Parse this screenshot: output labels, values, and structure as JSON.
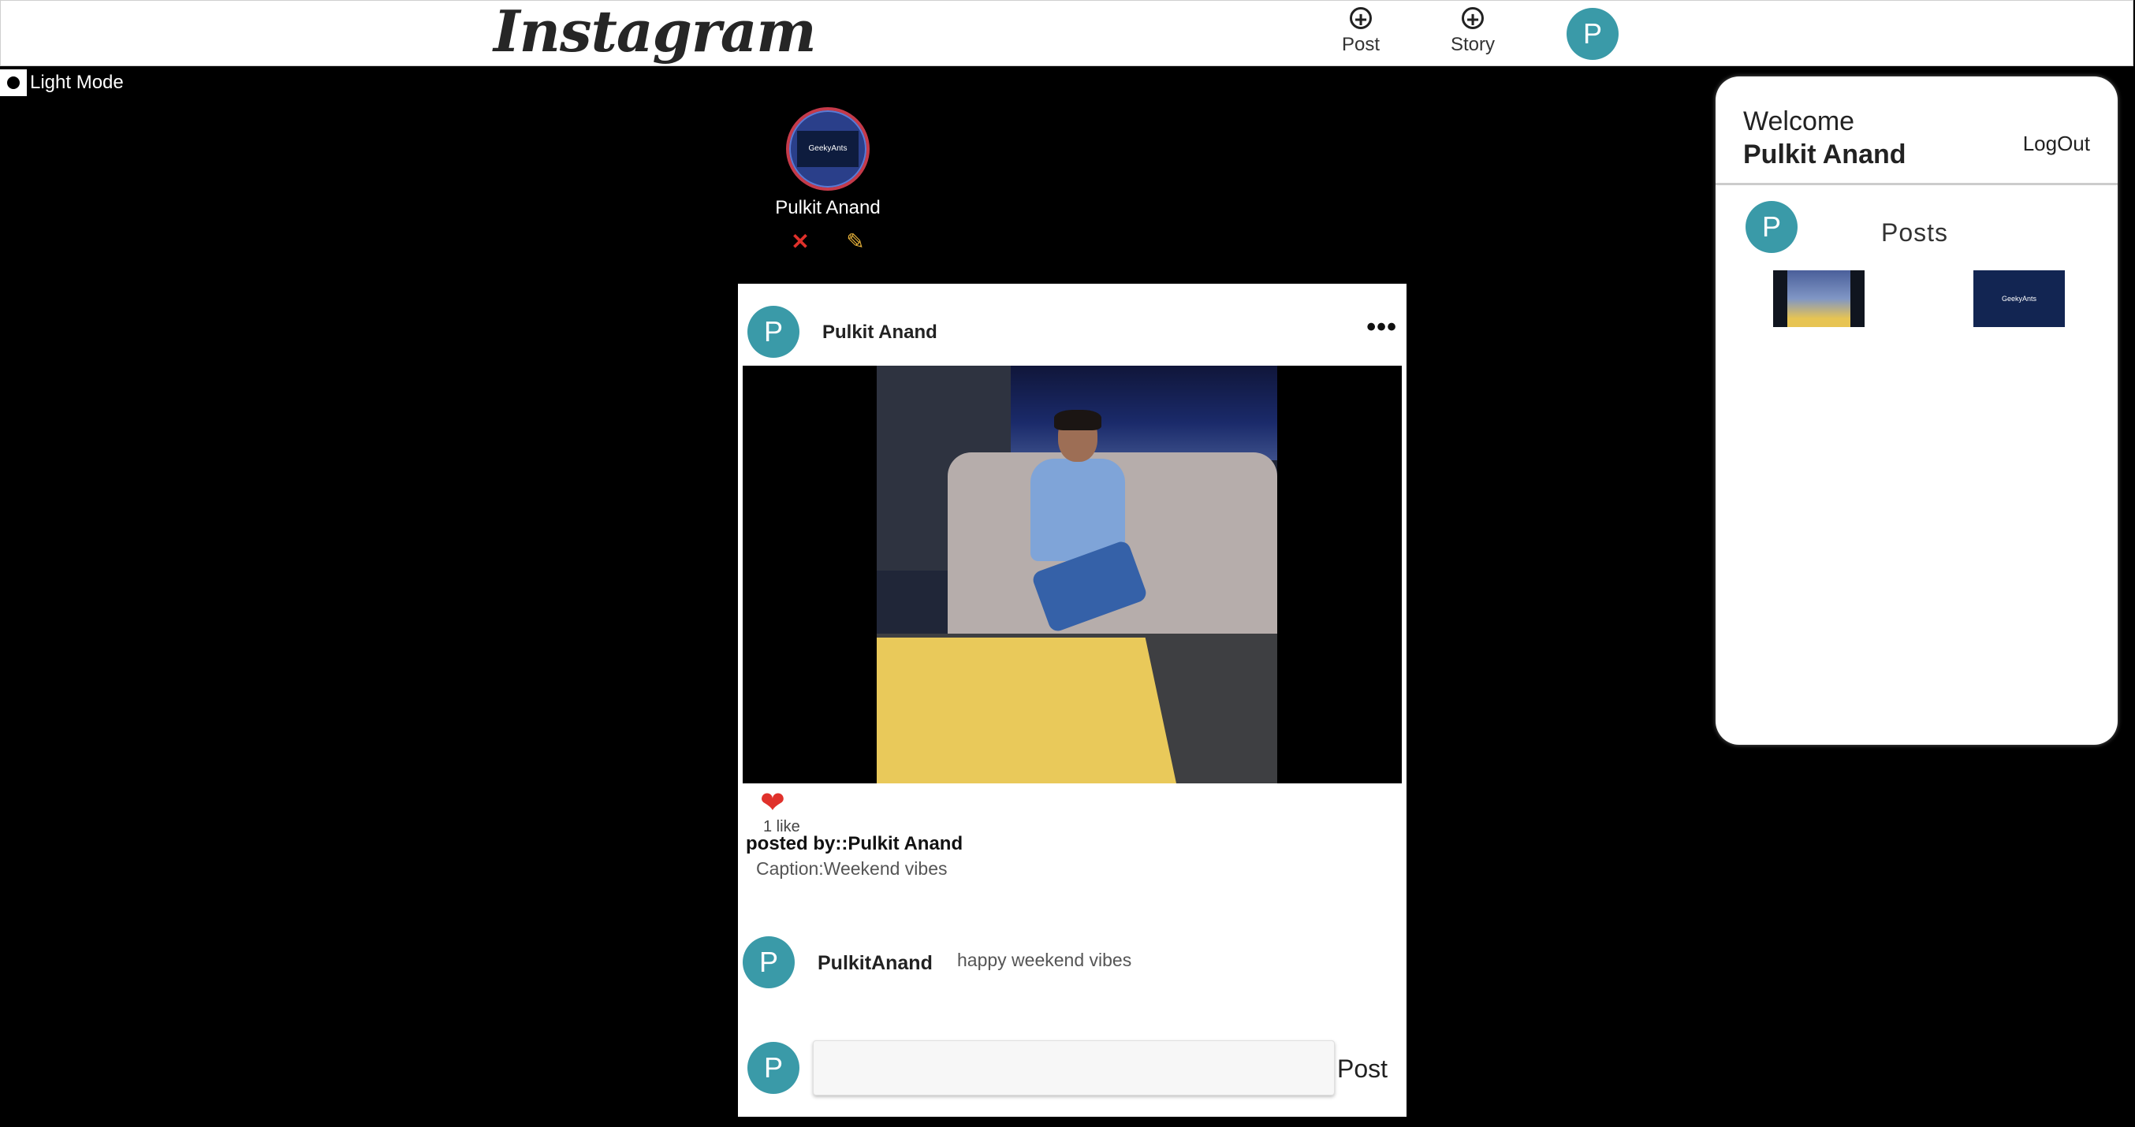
{
  "header": {
    "logo": "Instagram",
    "post_label": "Post",
    "story_label": "Story",
    "avatar_initial": "P"
  },
  "theme_toggle": {
    "label": "Light Mode"
  },
  "story": {
    "username": "Pulkit Anand",
    "thumb_text": "GeekyAnts"
  },
  "post": {
    "author_initial": "P",
    "author": "Pulkit Anand",
    "more_icon": "•••",
    "like_count": "1 like",
    "posted_by": "posted by::Pulkit Anand",
    "caption": "Caption:Weekend vibes",
    "comments": [
      {
        "initial": "P",
        "username": "PulkitAnand",
        "text": "happy weekend vibes"
      }
    ],
    "composer": {
      "avatar_initial": "P",
      "placeholder": "",
      "post_label": "Post"
    }
  },
  "sidebar": {
    "welcome": "Welcome",
    "username": "Pulkit Anand",
    "logout": "LogOut",
    "avatar_initial": "P",
    "posts_title": "Posts",
    "thumb2_text": "GeekyAnts"
  },
  "colors": {
    "avatar_bg": "#3a9aa8",
    "heart": "#e0312b",
    "background": "#000000"
  }
}
